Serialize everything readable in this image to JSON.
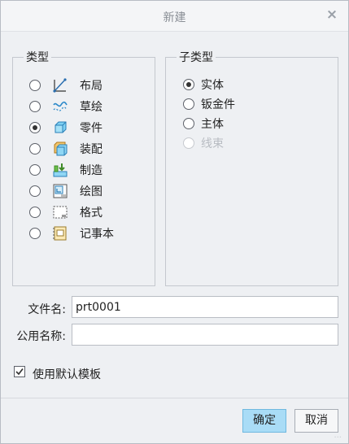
{
  "dialog": {
    "title": "新建",
    "close_symbol": "×"
  },
  "type_group": {
    "legend": "类型",
    "items": [
      {
        "label": "布局",
        "icon": "layout-icon",
        "checked": false
      },
      {
        "label": "草绘",
        "icon": "sketch-icon",
        "checked": false
      },
      {
        "label": "零件",
        "icon": "part-icon",
        "checked": true
      },
      {
        "label": "装配",
        "icon": "assembly-icon",
        "checked": false
      },
      {
        "label": "制造",
        "icon": "manufacturing-icon",
        "checked": false
      },
      {
        "label": "绘图",
        "icon": "drawing-icon",
        "checked": false
      },
      {
        "label": "格式",
        "icon": "format-icon",
        "checked": false
      },
      {
        "label": "记事本",
        "icon": "notebook-icon",
        "checked": false
      }
    ]
  },
  "subtype_group": {
    "legend": "子类型",
    "items": [
      {
        "label": "实体",
        "checked": true,
        "enabled": true
      },
      {
        "label": "钣金件",
        "checked": false,
        "enabled": true
      },
      {
        "label": "主体",
        "checked": false,
        "enabled": true
      },
      {
        "label": "线束",
        "checked": false,
        "enabled": false
      }
    ]
  },
  "file_name": {
    "label": "文件名:",
    "value": "prt0001"
  },
  "common_name": {
    "label": "公用名称:",
    "value": ""
  },
  "use_default_template": {
    "label": "使用默认模板",
    "checked": true
  },
  "buttons": {
    "ok": "确定",
    "cancel": "取消"
  },
  "watermark": "..."
}
